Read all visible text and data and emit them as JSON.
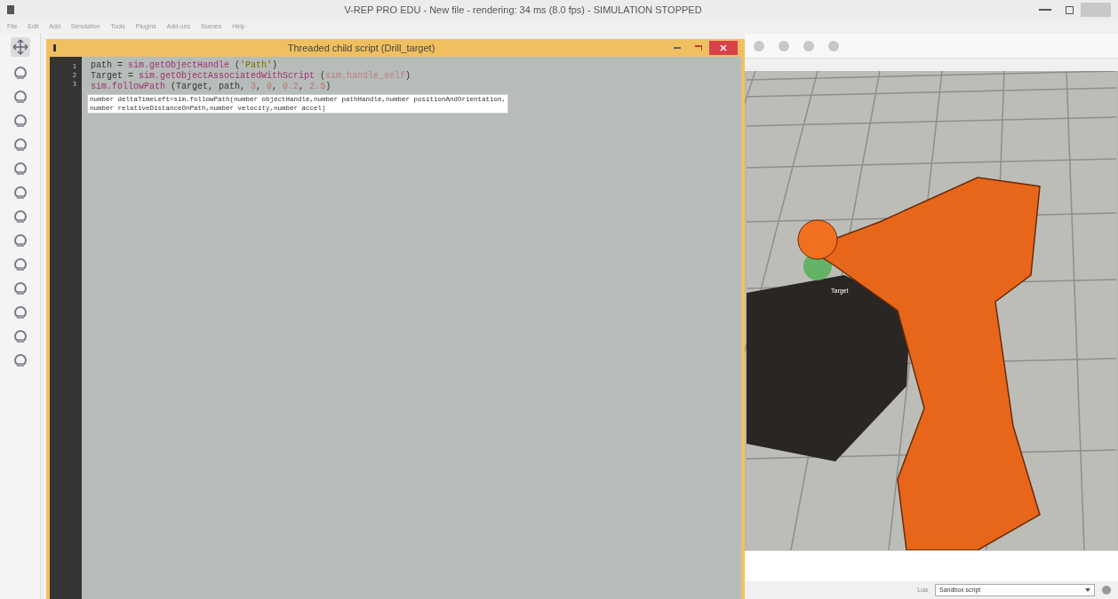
{
  "window": {
    "title": "V-REP PRO EDU - New file - rendering: 34 ms (8.0 fps) - SIMULATION STOPPED"
  },
  "menu": [
    "File",
    "Edit",
    "Add",
    "Simulation",
    "Tools",
    "Plugins",
    "Add-ons",
    "Scenes",
    "Help"
  ],
  "script_window": {
    "title": "Threaded child script (Drill_target)",
    "line_numbers": [
      "1",
      "2",
      "3"
    ],
    "lines": [
      [
        {
          "kind": "plain",
          "text": "path = "
        },
        {
          "kind": "func",
          "text": "sim.getObjectHandle"
        },
        {
          "kind": "plain",
          "text": " ("
        },
        {
          "kind": "string",
          "text": "'Path'"
        },
        {
          "kind": "plain",
          "text": ")"
        }
      ],
      [
        {
          "kind": "plain",
          "text": "Target = "
        },
        {
          "kind": "func",
          "text": "sim.getObjectAssociatedWithScript"
        },
        {
          "kind": "plain",
          "text": " ("
        },
        {
          "kind": "const",
          "text": "sim.handle_self"
        },
        {
          "kind": "plain",
          "text": ")"
        }
      ],
      [
        {
          "kind": "func",
          "text": "sim.followPath"
        },
        {
          "kind": "plain",
          "text": " (Target, path, "
        },
        {
          "kind": "number",
          "text": "3"
        },
        {
          "kind": "plain",
          "text": ", "
        },
        {
          "kind": "number",
          "text": "0"
        },
        {
          "kind": "plain",
          "text": ", "
        },
        {
          "kind": "number",
          "text": "0.2"
        },
        {
          "kind": "plain",
          "text": ", "
        },
        {
          "kind": "number",
          "text": "2.5"
        },
        {
          "kind": "plain",
          "text": ")"
        }
      ]
    ],
    "tooltip": [
      "number deltaTimeLeft=sim.followPath(number objectHandle,number pathHandle,number positionAndOrientation,",
      "number relativeDistanceOnPath,number velocity,number accel)"
    ]
  },
  "viewport": {
    "object_label": "Target"
  },
  "status_bar": {
    "language": "Lua",
    "script_selector": "Sandbox script"
  }
}
